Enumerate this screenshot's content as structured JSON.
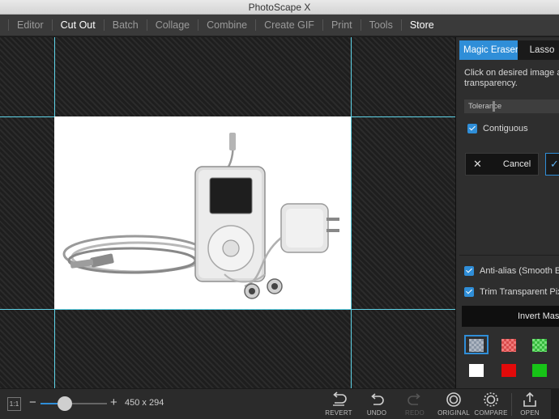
{
  "window": {
    "title": "PhotoScape X"
  },
  "menu": [
    {
      "label": "Editor",
      "active": false
    },
    {
      "label": "Cut Out",
      "active": true
    },
    {
      "label": "Batch",
      "active": false
    },
    {
      "label": "Collage",
      "active": false
    },
    {
      "label": "Combine",
      "active": false
    },
    {
      "label": "Create GIF",
      "active": false
    },
    {
      "label": "Print",
      "active": false
    },
    {
      "label": "Tools",
      "active": false
    },
    {
      "label": "Store",
      "active": true
    }
  ],
  "panel": {
    "tabs": [
      "Magic Eraser",
      "Lasso"
    ],
    "instruction": "Click on desired image a transparency.",
    "tolerance_label": "Tolerance",
    "tolerance_level": 0.27,
    "contiguous_label": "Contiguous",
    "cancel_label": "Cancel",
    "antialias_label": "Anti-alias (Smooth E",
    "trim_label": "Trim Transparent Pix",
    "invert_label": "Invert Mas",
    "swatch_colors": [
      "checker-blue",
      "checker-red",
      "checker-green",
      "#ffffff",
      "#e20a0a",
      "#17c417"
    ]
  },
  "bottom": {
    "zoom_reset_label": "1:1",
    "zoom_level": 0.36,
    "image_size": "450 x 294",
    "tools": [
      {
        "label": "REVERT",
        "icon": "revert-icon",
        "enabled": true
      },
      {
        "label": "UNDO",
        "icon": "undo-icon",
        "enabled": true
      },
      {
        "label": "REDO",
        "icon": "redo-icon",
        "enabled": false
      },
      {
        "label": "ORIGINAL",
        "icon": "original-icon",
        "enabled": true
      },
      {
        "label": "COMPARE",
        "icon": "compare-icon",
        "enabled": true
      },
      {
        "label": "OPEN",
        "icon": "open-icon",
        "enabled": true
      }
    ]
  },
  "colors": {
    "accent": "#2f8ed8",
    "guide": "#5fd4e8"
  }
}
